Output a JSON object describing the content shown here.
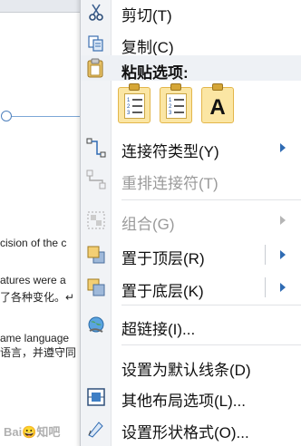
{
  "document": {
    "lines": [
      "cision of the c",
      "atures were a",
      "了各种变化。↵",
      "ame  language",
      "语言，并遵守同"
    ],
    "watermark": "Bai😀知吧"
  },
  "menu": {
    "items": {
      "cut": {
        "label": "剪切(T)",
        "icon": "scissors-icon"
      },
      "copy": {
        "label": "复制(C)",
        "icon": "copy-icon"
      },
      "paste_header": {
        "label": "粘贴选项:",
        "icon": "clipboard-icon"
      },
      "paste_options": [
        {
          "icon": "paste-keep-source-icon"
        },
        {
          "icon": "paste-use-destination-icon"
        },
        {
          "icon": "paste-text-only-icon",
          "glyph": "A"
        }
      ],
      "connector_type": {
        "label": "连接符类型(Y)",
        "icon": "connector-type-icon",
        "submenu": true
      },
      "reroute": {
        "label": "重排连接符(T)",
        "icon": "reroute-connector-icon",
        "disabled": true
      },
      "group": {
        "label": "组合(G)",
        "icon": "group-icon",
        "disabled": true,
        "submenu": true
      },
      "bring_front": {
        "label": "置于顶层(R)",
        "icon": "bring-to-front-icon",
        "submenu": true
      },
      "send_back": {
        "label": "置于底层(K)",
        "icon": "send-to-back-icon",
        "submenu": true
      },
      "hyperlink": {
        "label": "超链接(I)...",
        "icon": "hyperlink-globe-icon"
      },
      "default_line": {
        "label": "设置为默认线条(D)"
      },
      "layout": {
        "label": "其他布局选项(L)...",
        "icon": "layout-options-icon"
      },
      "format_shape": {
        "label": "设置形状格式(O)...",
        "icon": "format-shape-icon"
      }
    }
  },
  "colors": {
    "accent": "#2f6bb3",
    "paste_option_bg": "#fbe6a4",
    "disabled_text": "#9a9a9a",
    "icon_column": "#f1f3f6"
  }
}
